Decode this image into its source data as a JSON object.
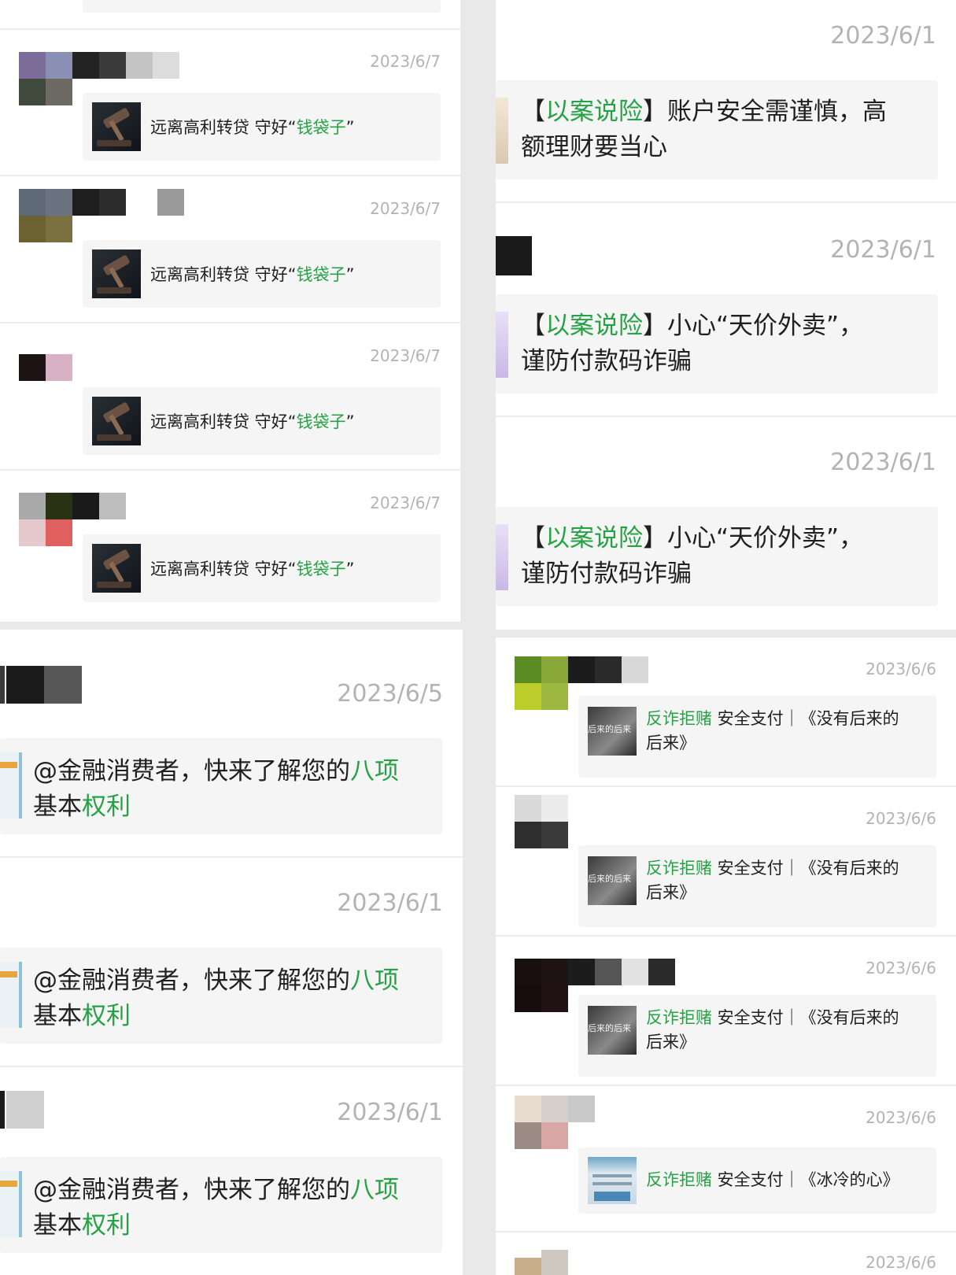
{
  "colors": {
    "accent_green": "#25a244",
    "date_gray": "#b3b3b3",
    "card_bg": "#f5f5f5"
  },
  "tl": [
    {
      "date": "2023/6/7",
      "title_pre": "远离高利转贷 守好“",
      "title_hl": "钱袋子",
      "title_post": "”"
    },
    {
      "date": "2023/6/7",
      "title_pre": "远离高利转贷 守好“",
      "title_hl": "钱袋子",
      "title_post": "”"
    },
    {
      "date": "2023/6/7",
      "title_pre": "远离高利转贷 守好“",
      "title_hl": "钱袋子",
      "title_post": "”"
    },
    {
      "date": "2023/6/7",
      "title_pre": "远离高利转贷 守好“",
      "title_hl": "钱袋子",
      "title_post": "”"
    }
  ],
  "bl": [
    {
      "date": "2023/6/5",
      "line1_pre": "@金融消费者，快来了解您的",
      "line1_hl": "八项",
      "line2_pre": "基本",
      "line2_hl": "权利"
    },
    {
      "date": "2023/6/1",
      "line1_pre": "@金融消费者，快来了解您的",
      "line1_hl": "八项",
      "line2_pre": "基本",
      "line2_hl": "权利"
    },
    {
      "date": "2023/6/1",
      "line1_pre": "@金融消费者，快来了解您的",
      "line1_hl": "八项",
      "line2_pre": "基本",
      "line2_hl": "权利"
    }
  ],
  "tr": [
    {
      "date": "2023/6/1",
      "br_open": "【",
      "tag": "以案说险",
      "br_close": "】",
      "line1": "账户安全需谨慎，高",
      "line2": "额理财要当心"
    },
    {
      "date": "2023/6/1",
      "br_open": "【",
      "tag": "以案说险",
      "br_close": "】",
      "line1": "小心“天价外卖”，",
      "line2": "谨防付款码诈骗"
    },
    {
      "date": "2023/6/1",
      "br_open": "【",
      "tag": "以案说险",
      "br_close": "】",
      "line1": "小心“天价外卖”，",
      "line2": "谨防付款码诈骗"
    }
  ],
  "br": [
    {
      "date": "2023/6/6",
      "tag": "反诈拒赌",
      "line1": " 安全支付｜《没有后来的",
      "line2": "后来》",
      "thumb_text": "后来的后来"
    },
    {
      "date": "2023/6/6",
      "tag": "反诈拒赌",
      "line1": " 安全支付｜《没有后来的",
      "line2": "后来》",
      "thumb_text": "后来的后来"
    },
    {
      "date": "2023/6/6",
      "tag": "反诈拒赌",
      "line1": " 安全支付｜《没有后来的",
      "line2": "后来》",
      "thumb_text": "后来的后来"
    },
    {
      "date": "2023/6/6",
      "tag": "反诈拒赌",
      "line1": " 安全支付｜《冰冷的心》",
      "line2": "",
      "thumb_text": ""
    },
    {
      "date": "2023/6/6"
    }
  ]
}
